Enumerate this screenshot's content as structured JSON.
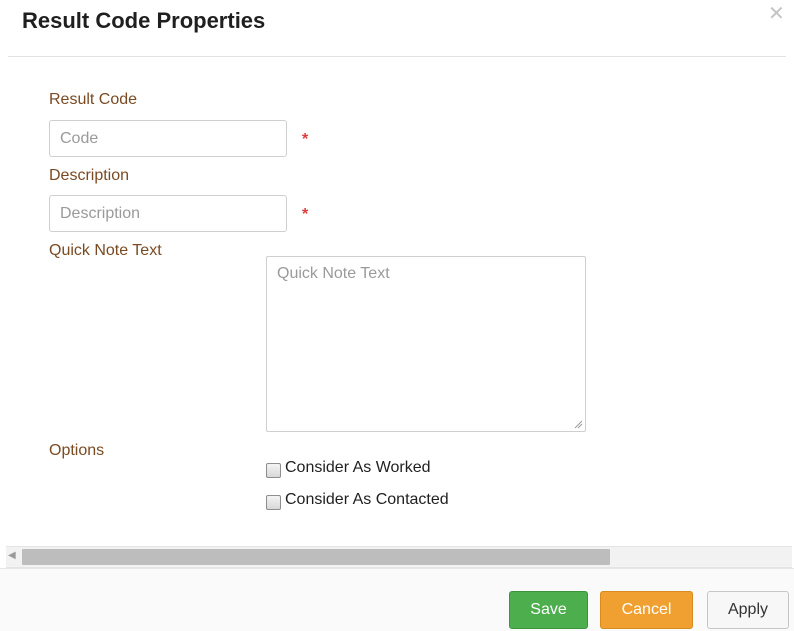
{
  "dialog": {
    "title": "Result Code Properties",
    "close_icon": "close-icon"
  },
  "form": {
    "result_code": {
      "label": "Result Code",
      "placeholder": "Code",
      "value": "",
      "required_mark": "*"
    },
    "description": {
      "label": "Description",
      "placeholder": "Description",
      "value": "",
      "required_mark": "*"
    },
    "quick_note": {
      "label": "Quick Note Text",
      "placeholder": "Quick Note Text",
      "value": ""
    },
    "options": {
      "label": "Options",
      "items": [
        {
          "label": "Consider As Worked",
          "checked": false
        },
        {
          "label": "Consider As Contacted",
          "checked": false
        }
      ]
    }
  },
  "footer": {
    "save_label": "Save",
    "cancel_label": "Cancel",
    "apply_label": "Apply"
  },
  "colors": {
    "label": "#7a4a22",
    "required": "#e03c3c",
    "save": "#4cae4c",
    "cancel": "#f0a030",
    "apply": "#f7f7f7"
  }
}
